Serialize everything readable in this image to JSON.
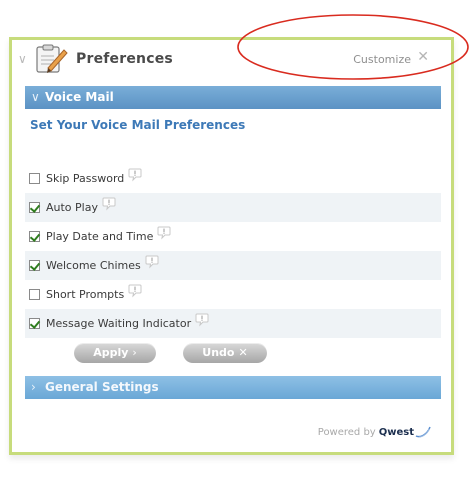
{
  "widget": {
    "title": "Preferences",
    "customize_label": "Customize",
    "close_glyph": "✕"
  },
  "voice_mail": {
    "section_label": "Voice Mail",
    "heading": "Set Your Voice Mail Preferences",
    "options": [
      {
        "label": "Skip Password",
        "checked": false
      },
      {
        "label": "Auto Play",
        "checked": true
      },
      {
        "label": "Play Date and Time",
        "checked": true
      },
      {
        "label": "Welcome Chimes",
        "checked": true
      },
      {
        "label": "Short Prompts",
        "checked": false
      },
      {
        "label": "Message Waiting Indicator",
        "checked": true
      }
    ],
    "apply_label": "Apply",
    "apply_glyph": "›",
    "undo_label": "Undo",
    "undo_glyph": "✕"
  },
  "general_settings": {
    "section_label": "General Settings"
  },
  "footer": {
    "powered_by": "Powered by",
    "brand": "Qwest"
  },
  "colors": {
    "frame_border": "#c7dc7c",
    "section_bar": "#5b92c4",
    "heading_blue": "#3d79b7",
    "annotation_red": "#d92b1f"
  }
}
